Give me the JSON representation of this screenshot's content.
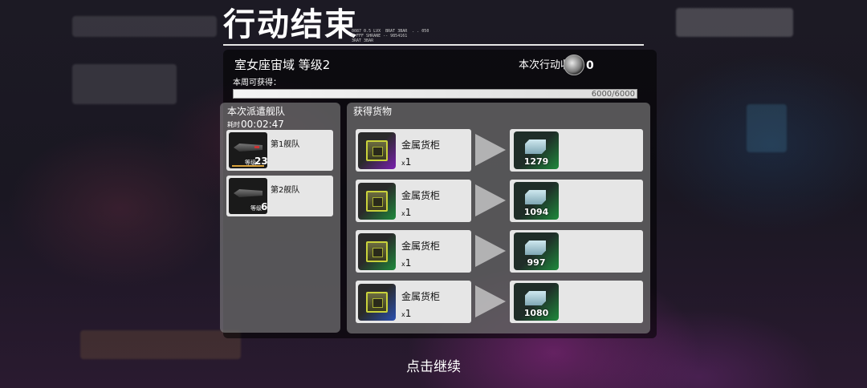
{
  "title": "行动结束",
  "title_meta": "0087 0.5 LVX  BRAT 3BAR  . . 050\n0 FFF SHRANE -- 9854161\n3RAT 3BAR",
  "sector": "室女座宙域 等级2",
  "harvest": {
    "label": "本次行动收获",
    "value": "0"
  },
  "weekly": {
    "label": "本周可获得：",
    "progress_text": "6000/6000",
    "progress_fraction": 1.0
  },
  "fleet": {
    "title": "本次派遣舰队",
    "time_label": "耗时",
    "time_value": "00:02:47",
    "items": [
      {
        "name": "第1舰队",
        "level_label": "等级",
        "level": "23"
      },
      {
        "name": "第2舰队",
        "level_label": "等级",
        "level": "6"
      }
    ]
  },
  "cargo": {
    "title": "获得货物",
    "items": [
      {
        "name": "金属货柜",
        "qty_prefix": "x",
        "qty": "1",
        "rarity_color": "#7a1fb0",
        "result": "1279"
      },
      {
        "name": "金属货柜",
        "qty_prefix": "x",
        "qty": "1",
        "rarity_color": "#1f8a3c",
        "result": "1094"
      },
      {
        "name": "金属货柜",
        "qty_prefix": "x",
        "qty": "1",
        "rarity_color": "#1f8a3c",
        "result": "997"
      },
      {
        "name": "金属货柜",
        "qty_prefix": "x",
        "qty": "1",
        "rarity_color": "#2a4fb0",
        "result": "1080"
      }
    ]
  },
  "continue_label": "点击继续"
}
